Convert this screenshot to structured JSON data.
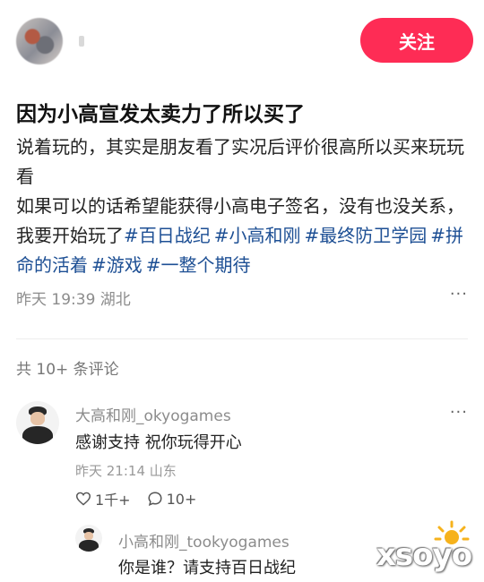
{
  "post": {
    "follow_label": "关注",
    "title": "因为小高宣发太卖力了所以买了",
    "body_line1": "说着玩的，其实是朋友看了实况后评价很高所以买来玩玩看",
    "body_line2_prefix": "如果可以的话希望能获得小高电子签名，没有也没关系，我要开始玩了",
    "tags": [
      "#百日战纪",
      "#小高和刚",
      "#最终防卫学园",
      "#拼命的活着",
      "#游戏",
      "#一整个期待"
    ],
    "meta": "昨天 19:39 湖北",
    "more": "···"
  },
  "comments_header": "共 10+ 条评论",
  "comments": [
    {
      "author": "大高和刚_okyogames",
      "text": "感谢支持 祝你玩得开心",
      "meta": "昨天 21:14 山东",
      "likes": "1千+",
      "replies": "10+",
      "more": "···"
    }
  ],
  "reply": {
    "author": "小高和刚_tookyogames",
    "text": "你是谁？请支持百日战纪"
  },
  "watermark": "xsoyo",
  "colors": {
    "accent": "#fe2c55",
    "tag": "#1d4f94"
  }
}
